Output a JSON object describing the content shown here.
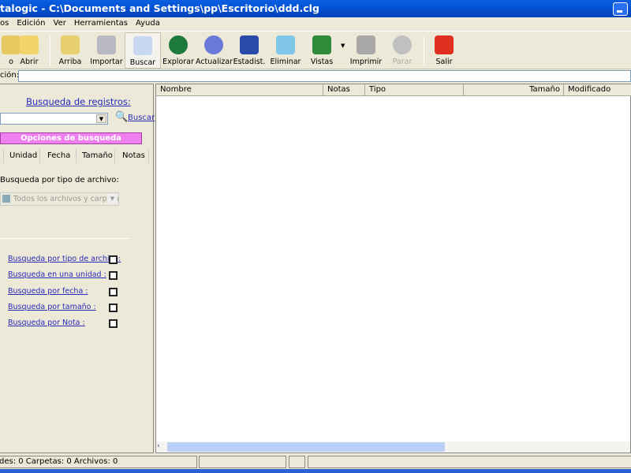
{
  "window": {
    "title": "talogic - C:\\Documents and Settings\\pp\\Escritorio\\ddd.clg"
  },
  "menu": [
    "os",
    "Edición",
    "Ver",
    "Herramientas",
    "Ayuda"
  ],
  "toolbar": [
    {
      "label": "o",
      "icon": "new-icon",
      "color": "#e8c860"
    },
    {
      "label": "Abrir",
      "icon": "open-folder-icon",
      "color": "#f2d46a"
    },
    {
      "label": "Arriba",
      "icon": "folder-up-icon",
      "color": "#e8d070"
    },
    {
      "label": "Importar",
      "icon": "import-disc-icon",
      "color": "#b8b8c0"
    },
    {
      "label": "Buscar",
      "icon": "magnifier-icon",
      "color": "#c8d8f0"
    },
    {
      "label": "Explorar",
      "icon": "globe-icon",
      "color": "#1e7a3a"
    },
    {
      "label": "Actualizar",
      "icon": "gear-icon",
      "color": "#6a78d8"
    },
    {
      "label": "Estadist.",
      "icon": "chart-check-icon",
      "color": "#2a4aa8"
    },
    {
      "label": "Eliminar",
      "icon": "recycle-bin-icon",
      "color": "#7fc6e8"
    },
    {
      "label": "Vistas",
      "icon": "views-icon",
      "color": "#2f8a3a"
    },
    {
      "label": "Imprimir",
      "icon": "printer-icon",
      "color": "#a8a8a8"
    },
    {
      "label": "Parar",
      "icon": "stop-icon",
      "color": "#c0c0c0"
    },
    {
      "label": "Salir",
      "icon": "exit-icon",
      "color": "#e03020"
    }
  ],
  "address": {
    "label": "ción:",
    "value": ""
  },
  "search": {
    "title": "Busqueda de registros:",
    "query": "",
    "button": "Buscar",
    "options_bar": "Opciones de busqueda",
    "options_color": "#f080f0",
    "tabs": [
      "Unidad",
      "Fecha",
      "Tamaño",
      "Notas"
    ],
    "type_label": "Busqueda por tipo de archivo:",
    "type_value": "Todos los archivos y carpetas",
    "filters": [
      {
        "label": "Busqueda por tipo de archivo:",
        "checked": false
      },
      {
        "label": "Busqueda en una unidad :",
        "checked": false
      },
      {
        "label": "Busqueda por fecha :",
        "checked": false
      },
      {
        "label": "Busqueda por tamaño :",
        "checked": false
      },
      {
        "label": "Busqueda por Nota :",
        "checked": false
      }
    ]
  },
  "list": {
    "columns": [
      "Nombre",
      "Notas",
      "Tipo",
      "Tamaño",
      "Modificado"
    ],
    "rows": []
  },
  "status": {
    "counts": "des: 0  Carpetas: 0  Archivos: 0",
    "p2": "",
    "p3": "",
    "p4": ""
  }
}
